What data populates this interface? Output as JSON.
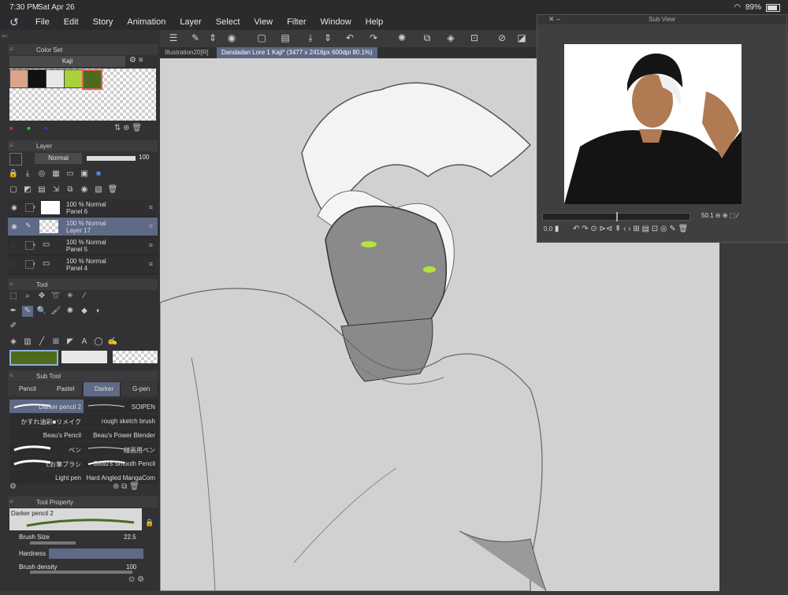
{
  "status_bar": {
    "time": "7:30 PM",
    "date": "Sat Apr 26",
    "battery": "89%"
  },
  "menu": [
    "File",
    "Edit",
    "Story",
    "Animation",
    "Layer",
    "Select",
    "View",
    "Filter",
    "Window",
    "Help"
  ],
  "color_set": {
    "title": "Color Set",
    "set_name": "Kaji",
    "swatches": [
      "#d9a48a",
      "#111111",
      "#e8e8e8",
      "#a8d13c",
      "#4c6b1c"
    ]
  },
  "layer_panel": {
    "title": "Layer",
    "blend_mode": "Normal",
    "opacity": "100",
    "layers": [
      {
        "opacity_mode": "100 % Normal",
        "name": "Panel 6"
      },
      {
        "opacity_mode": "100 % Normal",
        "name": "Layer 17"
      },
      {
        "opacity_mode": "100 % Normal",
        "name": "Panel 5"
      },
      {
        "opacity_mode": "100 % Normal",
        "name": "Panel 4"
      }
    ]
  },
  "tool_panel": {
    "title": "Tool",
    "main_color": "#4c6b1c",
    "sub_color": "#e8e8e8"
  },
  "sub_tool": {
    "title": "Sub Tool",
    "tabs": [
      "Pencil",
      "Pastel",
      "Darker",
      "G-pen"
    ],
    "brushes": [
      [
        "Darker pencil 2",
        "SOIPEN"
      ],
      [
        "かすれ油彩■リメイク",
        "rough sketch brush"
      ],
      [
        "Beau's Pencil",
        "Beau's Power Blender"
      ],
      [
        "ペン",
        "線画用ペン"
      ],
      [
        "Lお筆ブラシ",
        "Beau's Smooth Pencil"
      ],
      [
        "Light pen",
        "Hard Angled MangaCom"
      ]
    ]
  },
  "tool_property": {
    "title": "Tool Property",
    "brush_name": "Darker pencil 2",
    "brush_size_label": "Brush Size",
    "brush_size": "22.5",
    "hardness_label": "Hardness",
    "hardness_level": 0.5,
    "density_label": "Brush density",
    "density": "100"
  },
  "doc_tabs": [
    "Illustration20[R]",
    "Dandadan Lore 1 Kaji* (3477 x 2416px 600dpi 80.1%)"
  ],
  "sub_view": {
    "title": "Sub View",
    "zoom": "50.1",
    "rotation": "0.0"
  }
}
